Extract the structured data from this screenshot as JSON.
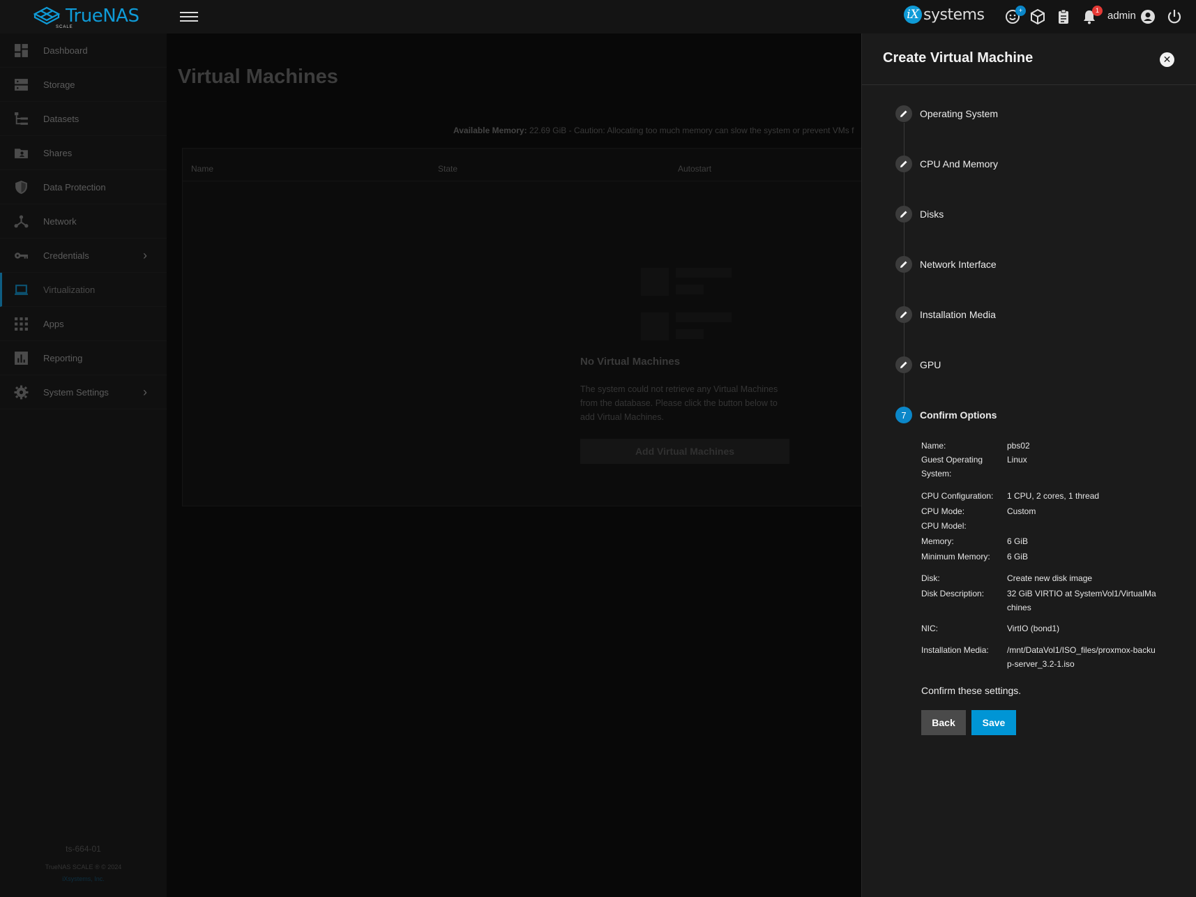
{
  "topbar": {
    "logo_text": "TrueNAS",
    "logo_sub": "SCALE",
    "vendor": "systems",
    "vendor_mark": "iX",
    "notif_count": "1",
    "user": "admin"
  },
  "sidebar": {
    "items": [
      {
        "label": "Dashboard"
      },
      {
        "label": "Storage"
      },
      {
        "label": "Datasets"
      },
      {
        "label": "Shares"
      },
      {
        "label": "Data Protection"
      },
      {
        "label": "Network"
      },
      {
        "label": "Credentials"
      },
      {
        "label": "Virtualization"
      },
      {
        "label": "Apps"
      },
      {
        "label": "Reporting"
      },
      {
        "label": "System Settings"
      }
    ],
    "hostname": "ts-664-01",
    "copyright": "TrueNAS SCALE ® © 2024",
    "company": "iXsystems, Inc."
  },
  "main": {
    "title": "Virtual Machines",
    "memory_label": "Available Memory:",
    "memory_text": "22.69 GiB - Caution: Allocating too much memory can slow the system or prevent VMs f",
    "columns": [
      "Name",
      "State",
      "Autostart"
    ],
    "empty_title": "No Virtual Machines",
    "empty_text": "The system could not retrieve any Virtual Machines from the database. Please click the button below to add Virtual Machines.",
    "empty_button": "Add Virtual Machines"
  },
  "panel": {
    "title": "Create Virtual Machine",
    "steps": [
      {
        "label": "Operating System"
      },
      {
        "label": "CPU And Memory"
      },
      {
        "label": "Disks"
      },
      {
        "label": "Network Interface"
      },
      {
        "label": "Installation Media"
      },
      {
        "label": "GPU"
      },
      {
        "label": "Confirm Options",
        "number": "7"
      }
    ],
    "summary": {
      "name_label": "Name:",
      "name_value": "pbs02",
      "guest_label": "Guest Operating System:",
      "guest_value": "Linux",
      "cpu_cfg_label": "CPU Configuration:",
      "cpu_cfg_value": "1 CPU, 2 cores, 1 thread",
      "cpu_mode_label": "CPU Mode:",
      "cpu_mode_value": "Custom",
      "cpu_model_label": "CPU Model:",
      "cpu_model_value": "",
      "memory_label": "Memory:",
      "memory_value": "6 GiB",
      "min_memory_label": "Minimum Memory:",
      "min_memory_value": "6 GiB",
      "disk_label": "Disk:",
      "disk_value": "Create new disk image",
      "disk_desc_label": "Disk Description:",
      "disk_desc_value": "32 GiB VIRTIO at SystemVol1/VirtualMachines",
      "nic_label": "NIC:",
      "nic_value": "VirtIO (bond1)",
      "media_label": "Installation Media:",
      "media_value": "/mnt/DataVol1/ISO_files/proxmox-backup-server_3.2-1.iso"
    },
    "confirm_text": "Confirm these settings.",
    "back_label": "Back",
    "save_label": "Save",
    "colors": {
      "accent": "#0b87c9",
      "save": "#0095d5",
      "back": "#4a4a4a"
    }
  }
}
